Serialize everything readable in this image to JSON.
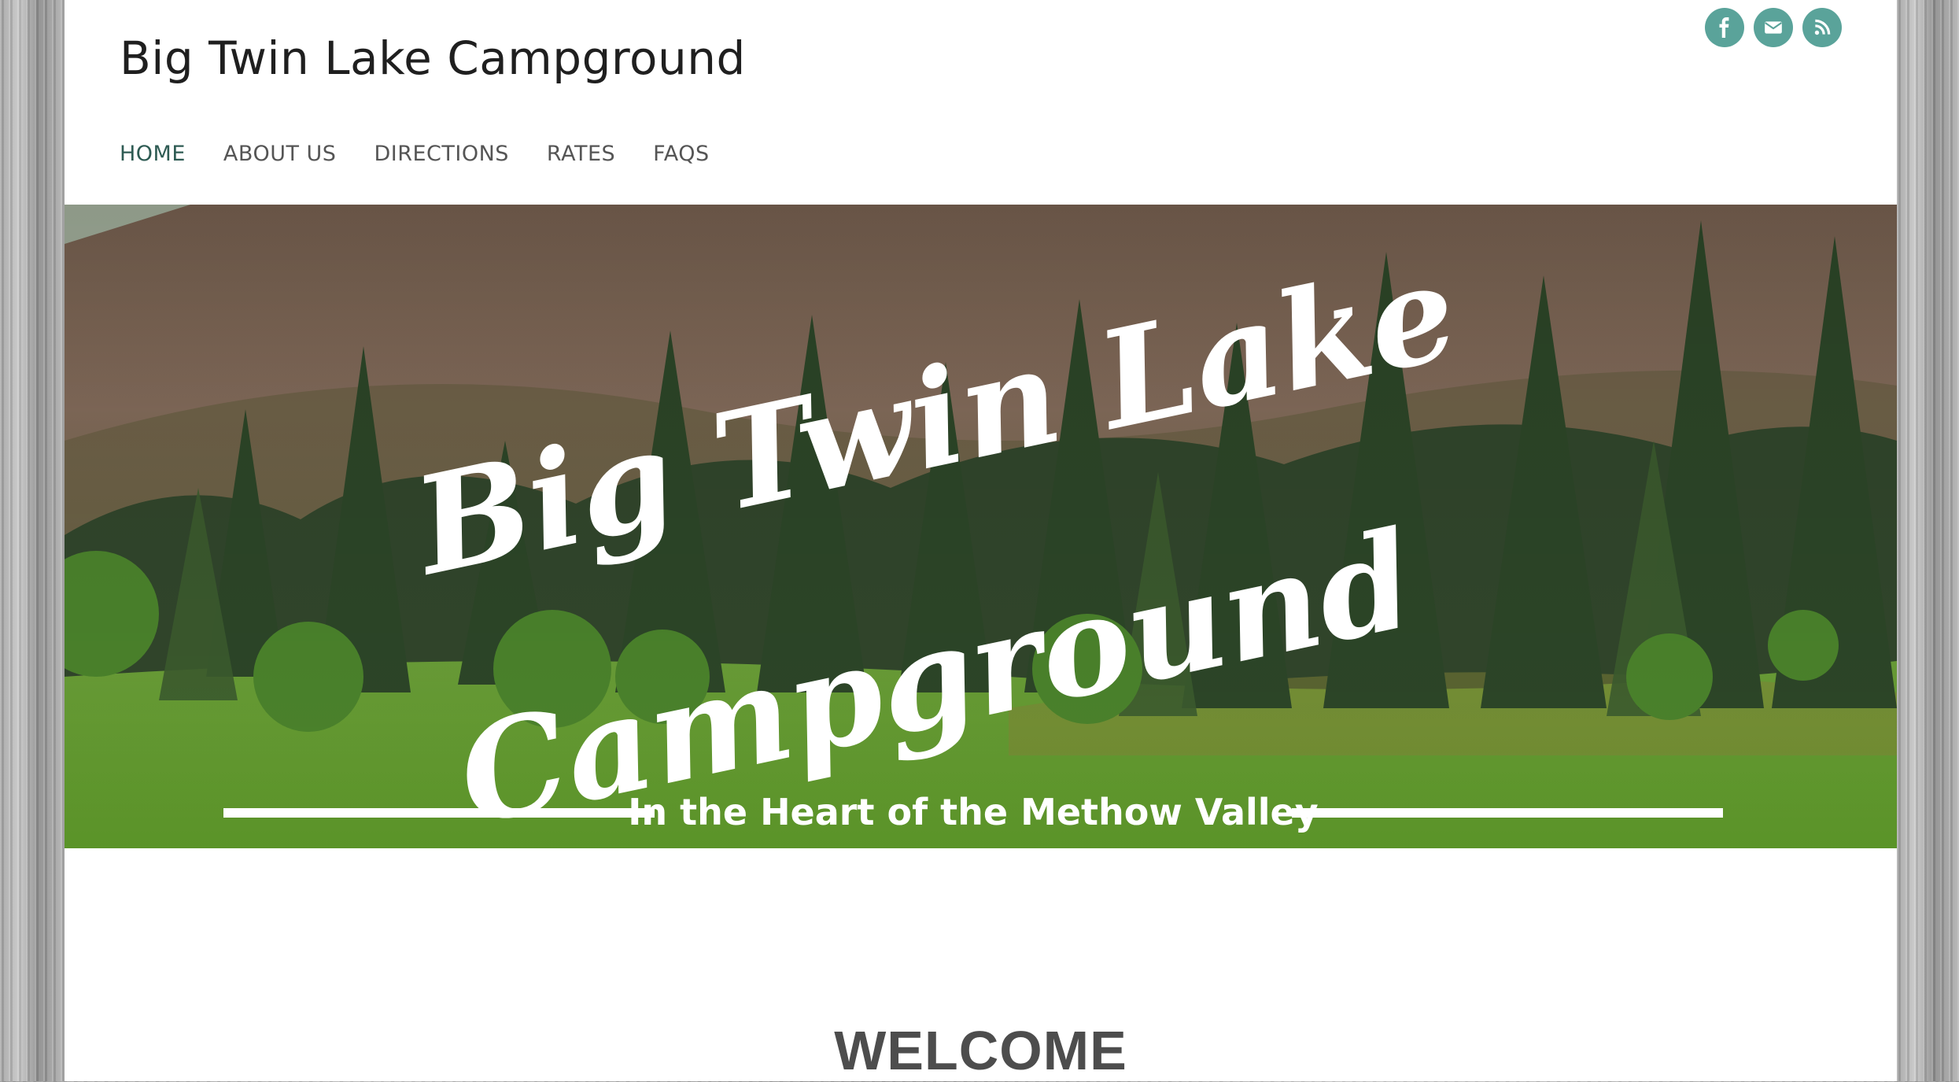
{
  "site": {
    "title": "Big Twin Lake Campground"
  },
  "social": [
    {
      "icon": "facebook-icon",
      "label": "f"
    },
    {
      "icon": "envelope-icon"
    },
    {
      "icon": "rss-icon"
    }
  ],
  "nav": {
    "items": [
      {
        "label": "HOME",
        "active": true
      },
      {
        "label": "ABOUT US",
        "active": false
      },
      {
        "label": "DIRECTIONS",
        "active": false
      },
      {
        "label": "RATES",
        "active": false
      },
      {
        "label": "FAQS",
        "active": false
      }
    ]
  },
  "hero": {
    "title_line1": "Big Twin Lake",
    "title_line2": "Campground",
    "tagline": "In the Heart of the Methow Valley"
  },
  "main": {
    "heading": "WELCOME"
  },
  "colors": {
    "accent": "#5aa39a",
    "nav_active": "#2e5b53",
    "heading": "#4d4d4d"
  }
}
